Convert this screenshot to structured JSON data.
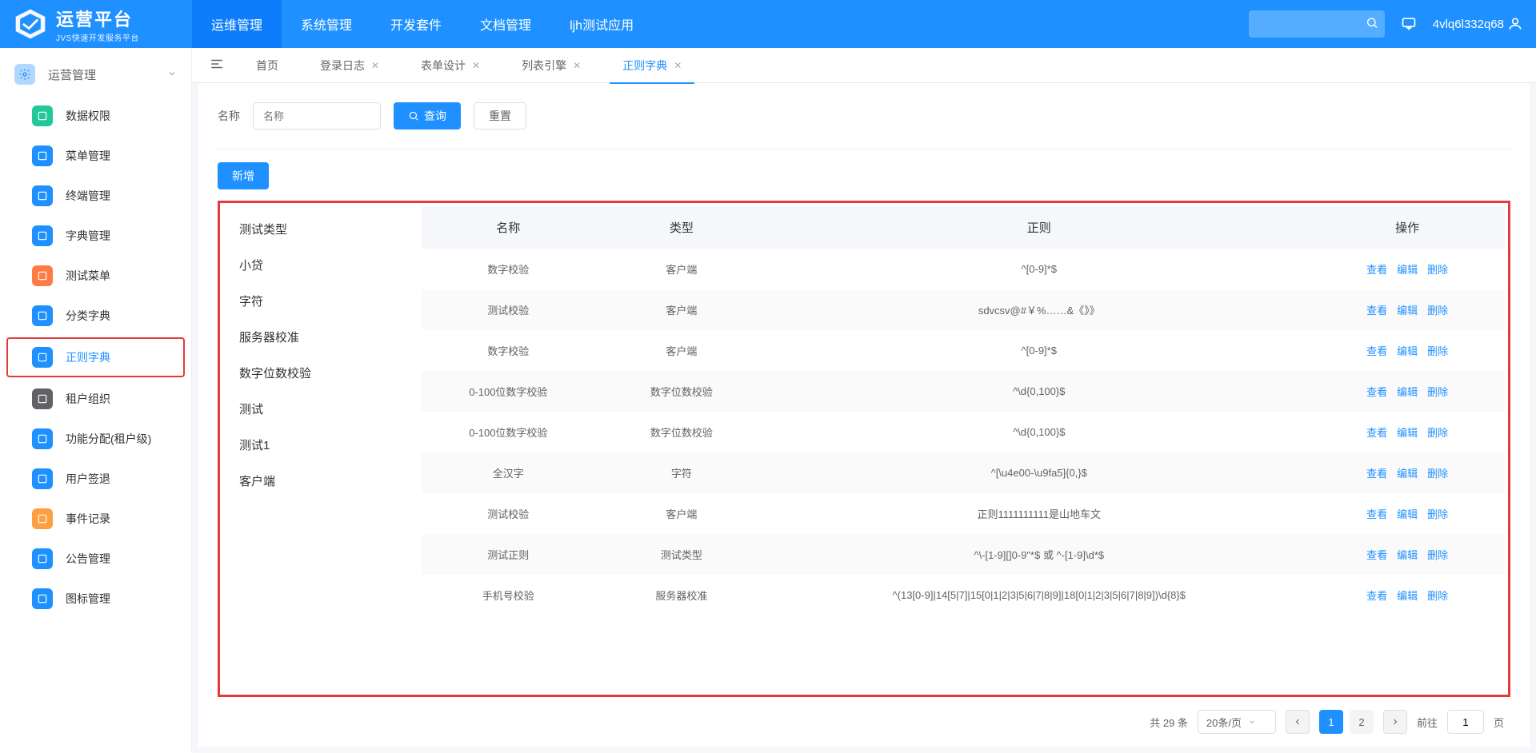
{
  "header": {
    "logo_title": "运营平台",
    "logo_subtitle": "JVS快速开发服务平台",
    "nav": [
      {
        "label": "运维管理",
        "active": true
      },
      {
        "label": "系统管理",
        "active": false
      },
      {
        "label": "开发套件",
        "active": false
      },
      {
        "label": "文档管理",
        "active": false
      },
      {
        "label": "ljh测试应用",
        "active": false
      }
    ],
    "username": "4vlq6l332q68"
  },
  "sidebar": {
    "section_title": "运营管理",
    "items": [
      {
        "label": "数据权限",
        "color": "#20c997"
      },
      {
        "label": "菜单管理",
        "color": "#1e90ff"
      },
      {
        "label": "终端管理",
        "color": "#1e90ff"
      },
      {
        "label": "字典管理",
        "color": "#1e90ff"
      },
      {
        "label": "测试菜单",
        "color": "#ff7a45"
      },
      {
        "label": "分类字典",
        "color": "#1e90ff"
      },
      {
        "label": "正则字典",
        "color": "#1e90ff",
        "active": true
      },
      {
        "label": "租户组织",
        "color": "#606266"
      },
      {
        "label": "功能分配(租户级)",
        "color": "#1e90ff"
      },
      {
        "label": "用户签退",
        "color": "#1e90ff"
      },
      {
        "label": "事件记录",
        "color": "#ff9f43"
      },
      {
        "label": "公告管理",
        "color": "#1e90ff"
      },
      {
        "label": "图标管理",
        "color": "#1e90ff"
      }
    ]
  },
  "tabs": [
    {
      "label": "首页",
      "closable": false,
      "active": false
    },
    {
      "label": "登录日志",
      "closable": true,
      "active": false
    },
    {
      "label": "表单设计",
      "closable": true,
      "active": false
    },
    {
      "label": "列表引擎",
      "closable": true,
      "active": false
    },
    {
      "label": "正则字典",
      "closable": true,
      "active": true
    }
  ],
  "search": {
    "label": "名称",
    "placeholder": "名称",
    "query_btn": "查询",
    "reset_btn": "重置"
  },
  "add_btn": "新增",
  "side_list": [
    "测试类型",
    "小贷",
    "字符",
    "服务器校准",
    "数字位数校验",
    "测试",
    "测试1",
    "客户端"
  ],
  "table": {
    "headers": [
      "名称",
      "类型",
      "正则",
      "操作"
    ],
    "rows": [
      {
        "name": "数字校验",
        "type": "客户端",
        "regex": "^[0-9]*$"
      },
      {
        "name": "测试校验",
        "type": "客户端",
        "regex": "sdvcsv@#￥%……&《》》"
      },
      {
        "name": "数字校验",
        "type": "客户端",
        "regex": "^[0-9]*$"
      },
      {
        "name": "0-100位数字校验",
        "type": "数字位数校验",
        "regex": "^\\d{0,100}$"
      },
      {
        "name": "0-100位数字校验",
        "type": "数字位数校验",
        "regex": "^\\d{0,100}$"
      },
      {
        "name": "全汉字",
        "type": "字符",
        "regex": "^[\\u4e00-\\u9fa5]{0,}$"
      },
      {
        "name": "测试校验",
        "type": "客户端",
        "regex": "正则1111111111是山地车文"
      },
      {
        "name": "测试正则",
        "type": "测试类型",
        "regex": "^\\-[1-9][]0-9\"*$ 或 ^-[1-9]\\d*$"
      },
      {
        "name": "手机号校验",
        "type": "服务器校准",
        "regex": "^(13[0-9]|14[5|7]|15[0|1|2|3|5|6|7|8|9]|18[0|1|2|3|5|6|7|8|9])\\d{8}$"
      }
    ],
    "op_labels": {
      "view": "查看",
      "edit": "编辑",
      "delete": "删除"
    }
  },
  "pagination": {
    "total_text": "共 29 条",
    "page_size": "20条/页",
    "current": "1",
    "pages": [
      "1",
      "2"
    ],
    "goto_label": "前往",
    "goto_suffix": "页",
    "goto_value": "1"
  }
}
